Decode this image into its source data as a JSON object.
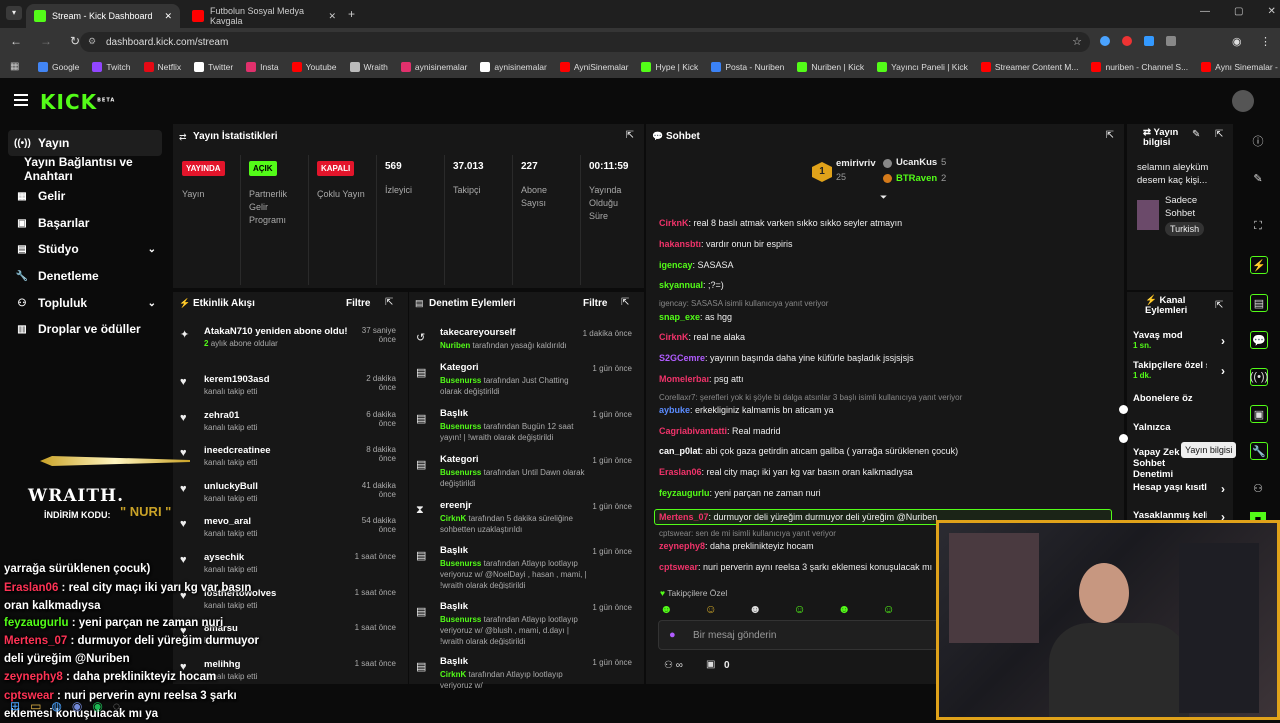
{
  "browser": {
    "tabs": [
      {
        "title": "Stream - Kick Dashboard"
      },
      {
        "title": "Futbolun Sosyal Medya Kavgala"
      }
    ],
    "url": "dashboard.kick.com/stream",
    "bookmarks": [
      "Google",
      "Twitch",
      "Netflix",
      "Twitter",
      "Insta",
      "Youtube",
      "Wraith",
      "aynisinemalar",
      "aynisinemalar",
      "AyniSinemalar",
      "Hype | Kick",
      "Posta - Nuriben",
      "Nuriben | Kick",
      "Yayıncı Paneli | Kick",
      "Streamer Content M...",
      "nuriben - Channel S...",
      "Aynı Sinemalar - Ça..."
    ]
  },
  "brand": {
    "logo": "KICK",
    "beta": "BETA",
    "accent": "#53fc18"
  },
  "sidebar": {
    "items": [
      {
        "label": "Yayın"
      },
      {
        "label": "Yayın Bağlantısı ve Anahtarı"
      },
      {
        "label": "Gelir"
      },
      {
        "label": "Başarılar"
      },
      {
        "label": "Stüdyo"
      },
      {
        "label": "Denetleme"
      },
      {
        "label": "Topluluk"
      },
      {
        "label": "Droplar ve ödüller"
      }
    ]
  },
  "stats": {
    "title": "Yayın İstatistikleri",
    "cells": [
      {
        "badge": "YAYINDA",
        "label": "Yayın"
      },
      {
        "badge": "AÇIK",
        "label": "Partnerlik Gelir Programı"
      },
      {
        "badge": "KAPALI",
        "label": "Çoklu Yayın"
      },
      {
        "value": "569",
        "label": "İzleyici"
      },
      {
        "value": "37.013",
        "label": "Takipçi"
      },
      {
        "value": "227",
        "label": "Abone Sayısı"
      },
      {
        "value": "00:11:59",
        "label": "Yayında Olduğu Süre"
      }
    ]
  },
  "activity": {
    "title": "Etkinlik Akışı",
    "filter": "Filtre",
    "items": [
      {
        "name": "AtakaN710 yeniden abone oldu!",
        "months": "2",
        "sub": "aylık abone oldular",
        "time": "37 saniye önce"
      },
      {
        "name": "kerem1903asd",
        "sub": "kanalı takip etti",
        "time": "2 dakika önce"
      },
      {
        "name": "zehra01",
        "sub": "kanalı takip etti",
        "time": "6 dakika önce"
      },
      {
        "name": "ineedcreatinee",
        "sub": "kanalı takip etti",
        "time": "8 dakika önce"
      },
      {
        "name": "unluckyBull",
        "sub": "kanalı takip etti",
        "time": "41 dakika önce"
      },
      {
        "name": "mevo_aral",
        "sub": "kanalı takip etti",
        "time": "54 dakika önce"
      },
      {
        "name": "aysechik",
        "sub": "kanalı takip etti",
        "time": "1 saat önce"
      },
      {
        "name": "losthertowolves",
        "sub": "kanalı takip etti",
        "time": "1 saat önce"
      },
      {
        "name": "8marsu",
        "sub": "kanalı takip etti",
        "time": "1 saat önce"
      },
      {
        "name": "melihhg",
        "sub": "kanalı takip etti",
        "time": "1 saat önce"
      }
    ]
  },
  "modlog": {
    "title": "Denetim Eylemleri",
    "filter": "Filtre",
    "items": [
      {
        "title": "takecareyourself",
        "actor": "Nuriben",
        "text": "tarafından yasağı kaldırıldı",
        "time": "1 dakika önce"
      },
      {
        "title": "Kategori",
        "actor": "Busenurss",
        "text": "tarafından Just Chatting olarak değiştirildi",
        "time": "1 gün önce"
      },
      {
        "title": "Başlık",
        "actor": "Busenurss",
        "text": "tarafından Bugün 12 saat yayın! | !wraith olarak değiştirildi",
        "time": "1 gün önce"
      },
      {
        "title": "Kategori",
        "actor": "Busenurss",
        "text": "tarafından Until Dawn olarak değiştirildi",
        "time": "1 gün önce"
      },
      {
        "title": "ereenjr",
        "actor": "CirknK",
        "text": "tarafından 5 dakika süreliğine sohbetten uzaklaştırıldı",
        "time": "1 gün önce"
      },
      {
        "title": "Başlık",
        "actor": "Busenurss",
        "text": "tarafından Atlayıp lootlayıp veriyoruz w/ @NoelDayi , hasan , mami, | !wraith olarak değiştirildi",
        "time": "1 gün önce"
      },
      {
        "title": "Başlık",
        "actor": "Busenurss",
        "text": "tarafından Atlayıp lootlayıp veriyoruz w/ @blush , mami, d.dayı | !wraith olarak değiştirildi",
        "time": "1 gün önce"
      },
      {
        "title": "Başlık",
        "actor": "CirknK",
        "text": "tarafından Atlayıp lootlayıp veriyoruz w/",
        "time": "1 gün önce"
      }
    ]
  },
  "chat": {
    "title": "Sohbet",
    "top": {
      "first": "emirivriv",
      "first_count": "25",
      "second": "UcanKus",
      "second_count": "5",
      "third": "BTRaven",
      "third_count": "2",
      "rank": "1"
    },
    "messages": [
      {
        "user": "CirknK",
        "color": "#f0336a",
        "text": ": real 8 baslı atmak varken sıkko sıkko seyler atmayın"
      },
      {
        "user": "hakansbtı",
        "color": "#f0336a",
        "text": ": vardır onun bir espiris"
      },
      {
        "user": "igencay",
        "color": "#53fc18",
        "text": ": SASASA"
      },
      {
        "user": "skyannual",
        "color": "#53fc18",
        "text": ": ;?=)"
      },
      {
        "reply": "igencay: SASASA isimli kullanıcıya yanıt veriyor"
      },
      {
        "user": "snap_exe",
        "color": "#53fc18",
        "text": ": as hgg"
      },
      {
        "user": "CirknK",
        "color": "#f0336a",
        "text": ": real ne alaka"
      },
      {
        "user": "S2GCemre",
        "color": "#b15cff",
        "text": ": yayının başında daha yine küfürle başladık jssjsjsjs"
      },
      {
        "user": "Momelerbaı",
        "color": "#f0336a",
        "text": ": psg attı"
      },
      {
        "reply": "Corellaxr7: şerefleri yok ki şöyle bi dalga atsınlar 3 başlı isimli kullanıcıya yanıt veriyor"
      },
      {
        "user": "aybuke",
        "color": "#5b8cff",
        "text": ": erkekliginiz kalmamis bn aticam ya"
      },
      {
        "user": "Cagriabivantatti",
        "color": "#f0336a",
        "text": ": Real madrid"
      },
      {
        "user": "can_p0lat",
        "color": "#ffffff",
        "text": ": abi çok gaza getirdin atıcam galiba ( yarrağa sürüklenen çocuk)"
      },
      {
        "user": "Eraslan06",
        "color": "#f0336a",
        "text": ": real city maçı iki yarı kg var basın oran kalkmadıysa"
      },
      {
        "user": "feyzaugurlu",
        "color": "#53fc18",
        "text": ": yeni parçan ne zaman nuri"
      },
      {
        "user": "Mertens_07",
        "color": "#f0336a",
        "text": ": durmuyor deli yüreğim durmuyor deli yüreğim @Nuriben",
        "highlight": true
      },
      {
        "reply": "cptswear: sen de mi isimli kullanıcıya yanıt veriyor"
      },
      {
        "user": "zeynephy8",
        "color": "#f0336a",
        "text": ": daha preklinikteyiz hocam"
      },
      {
        "user": "cptswear",
        "color": "#f0336a",
        "text": ": nuri perverin aynı reelsa 3 şarkı eklemesi konuşulacak mı"
      }
    ],
    "followers_only": "Takipçilere Özel",
    "input_placeholder": "Bir mesaj gönderin",
    "footer_count": "0"
  },
  "stream_info": {
    "title": "Yayın bilgisi",
    "text": "selamın aleyküm desem kaç kişi...",
    "category": "Sadece Sohbet",
    "language": "Turkish"
  },
  "channel_actions": {
    "title": "Kanal Eylemleri",
    "items": [
      {
        "label": "Yavaş mod",
        "sub": "1 sn.",
        "kind": "arrow"
      },
      {
        "label": "Takipçilere özel s",
        "sub": "1 dk.",
        "kind": "arrow"
      },
      {
        "label": "Abonelere öz",
        "kind": "toggle"
      },
      {
        "label": "Yalnızca",
        "kind": "toggle"
      },
      {
        "label": "Yapay Zek Sohbet Denetimi",
        "kind": "none"
      },
      {
        "label": "Hesap yaşı kısıtla",
        "kind": "arrow"
      },
      {
        "label": "Yasaklanmış kelin",
        "kind": "arrow"
      }
    ]
  },
  "tooltip": "Yayın bilgisi",
  "overlay": {
    "brand": "WRAITH.",
    "code_label": "İNDİRİM KODU:",
    "code": "\" NURI \"",
    "lines": [
      {
        "user": "",
        "text": "yarrağa sürüklenen çocuk)",
        "color": "#ffffff"
      },
      {
        "user": "Eraslan06",
        "text": " : real city maçı iki yarı kg var basın oran kalkmadıysa",
        "color": "#ff3355"
      },
      {
        "user": "feyzaugurlu",
        "text": " : yeni parçan ne zaman nuri",
        "color": "#53fc18"
      },
      {
        "user": "Mertens_07",
        "text": " : durmuyor deli yüreğim durmuyor deli yüreğim @Nuriben",
        "color": "#ff3355"
      },
      {
        "user": "zeynephy8",
        "text": " : daha preklinikteyiz hocam",
        "color": "#ff3355"
      },
      {
        "user": "cptswear",
        "text": " : nuri perverin aynı reelsa 3 şarkı eklemesi konuşulacak mı ya",
        "color": "#ff3355"
      }
    ]
  }
}
